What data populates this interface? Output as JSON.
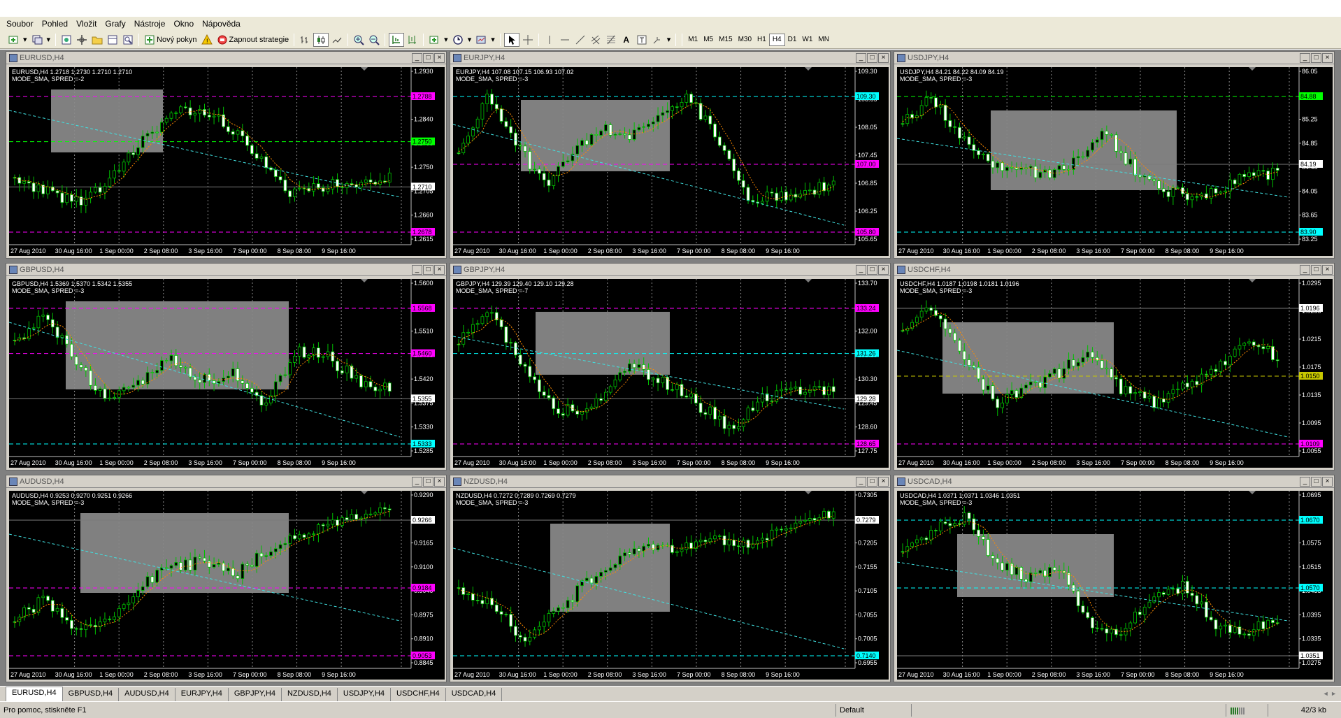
{
  "menu": [
    "Soubor",
    "Pohled",
    "Vložit",
    "Grafy",
    "Nástroje",
    "Okno",
    "Nápověda"
  ],
  "toolbar": {
    "new_order": "Nový pokyn",
    "start_strategies": "Zapnout strategie",
    "timeframes": [
      "M1",
      "M5",
      "M15",
      "M30",
      "H1",
      "H4",
      "D1",
      "W1",
      "MN"
    ],
    "active_timeframe": "H4"
  },
  "x_labels": [
    "27 Aug 2010",
    "30 Aug 16:00",
    "1 Sep 00:00",
    "2 Sep 08:00",
    "3 Sep 16:00",
    "7 Sep 00:00",
    "8 Sep 08:00",
    "9 Sep 16:00"
  ],
  "charts": [
    {
      "title": "EURUSD,H4",
      "info": "EURUSD,H4  1.2718 1.2730 1.2710 1.2710",
      "info2": "MODE_SMA, SPRED =-2",
      "ticks": [
        "1.2930",
        "1.2885",
        "1.2840",
        "1.2795",
        "1.2750",
        "1.2705",
        "1.2660",
        "1.2615"
      ],
      "tags": [
        {
          "text": "1.2788",
          "color": "#ff00ff"
        },
        {
          "text": "1.2750",
          "color": "#00ff00"
        },
        {
          "text": "1.2710",
          "color": "#ffffff"
        },
        {
          "text": "1.2678",
          "color": "#ff00ff"
        }
      ]
    },
    {
      "title": "EURJPY,H4",
      "info": "EURJPY,H4  107.08 107.15 106.93 107.02",
      "info2": "MODE_SMA, SPRED =-3",
      "ticks": [
        "109.30",
        "108.65",
        "108.05",
        "107.45",
        "106.85",
        "106.25",
        "105.65"
      ],
      "tags": [
        {
          "text": "109.30",
          "color": "#00ffff"
        },
        {
          "text": "107.00",
          "color": "#ff00ff"
        },
        {
          "text": "105.80",
          "color": "#ff00ff"
        }
      ]
    },
    {
      "title": "USDJPY,H4",
      "info": "USDJPY,H4  84.21 84.22 84.09 84.19",
      "info2": "MODE_SMA, SPRED =-3",
      "ticks": [
        "86.05",
        "85.65",
        "85.25",
        "84.85",
        "84.45",
        "84.05",
        "83.65",
        "83.25"
      ],
      "tags": [
        {
          "text": "84.88",
          "color": "#00ff00"
        },
        {
          "text": "84.19",
          "color": "#ffffff"
        },
        {
          "text": "83.90",
          "color": "#00ffff"
        }
      ]
    },
    {
      "title": "GBPUSD,H4",
      "info": "GBPUSD,H4  1.5369 1.5370 1.5342 1.5355",
      "info2": "MODE_SMA, SPRED =-3",
      "ticks": [
        "1.5600",
        "1.5555",
        "1.5510",
        "1.5465",
        "1.5420",
        "1.5375",
        "1.5330",
        "1.5285"
      ],
      "tags": [
        {
          "text": "1.5568",
          "color": "#ff00ff"
        },
        {
          "text": "1.5460",
          "color": "#ff00ff"
        },
        {
          "text": "1.5355",
          "color": "#ffffff"
        },
        {
          "text": "1.5333",
          "color": "#00ffff"
        }
      ]
    },
    {
      "title": "GBPJPY,H4",
      "info": "GBPJPY,H4  129.39 129.40 129.10 129.28",
      "info2": "MODE_SMA, SPRED =-7",
      "ticks": [
        "133.70",
        "132.85",
        "132.00",
        "131.15",
        "130.30",
        "129.45",
        "128.60",
        "127.75"
      ],
      "tags": [
        {
          "text": "133.24",
          "color": "#ff00ff"
        },
        {
          "text": "131.26",
          "color": "#00ffff"
        },
        {
          "text": "129.28",
          "color": "#ffffff"
        },
        {
          "text": "128.65",
          "color": "#ff00ff"
        }
      ]
    },
    {
      "title": "USDCHF,H4",
      "info": "USDCHF,H4  1.0187 1.0198 1.0181 1.0196",
      "info2": "MODE_SMA, SPRED =-3",
      "ticks": [
        "1.0295",
        "1.0255",
        "1.0215",
        "1.0175",
        "1.0135",
        "1.0095",
        "1.0055"
      ],
      "tags": [
        {
          "text": "1.0196",
          "color": "#ffffff"
        },
        {
          "text": "1.0150",
          "color": "#c8c800"
        },
        {
          "text": "1.0109",
          "color": "#ff00ff"
        }
      ]
    },
    {
      "title": "AUDUSD,H4",
      "info": "AUDUSD,H4  0.9253 0.9270 0.9251 0.9266",
      "info2": "MODE_SMA, SPRED =-3",
      "ticks": [
        "0.9290",
        "0.9225",
        "0.9165",
        "0.9100",
        "0.9040",
        "0.8975",
        "0.8910",
        "0.8845"
      ],
      "tags": [
        {
          "text": "0.9266",
          "color": "#ffffff"
        },
        {
          "text": "0.9184",
          "color": "#ff00ff"
        },
        {
          "text": "0.9053",
          "color": "#ff00ff"
        }
      ]
    },
    {
      "title": "NZDUSD,H4",
      "info": "NZDUSD,H4  0.7272 0.7289 0.7269 0.7279",
      "info2": "MODE_SMA, SPRED =-3",
      "ticks": [
        "0.7305",
        "0.7255",
        "0.7205",
        "0.7155",
        "0.7105",
        "0.7055",
        "0.7005",
        "0.6955"
      ],
      "tags": [
        {
          "text": "0.7279",
          "color": "#ffffff"
        },
        {
          "text": "0.7140",
          "color": "#00ffff"
        }
      ]
    },
    {
      "title": "USDCAD,H4",
      "info": "USDCAD,H4  1.0371 1.0371 1.0346 1.0351",
      "info2": "MODE_SMA, SPRED =-3",
      "ticks": [
        "1.0695",
        "1.0635",
        "1.0575",
        "1.0515",
        "1.0455",
        "1.0395",
        "1.0335",
        "1.0275"
      ],
      "tags": [
        {
          "text": "1.0670",
          "color": "#00ffff"
        },
        {
          "text": "1.0570",
          "color": "#00ffff"
        },
        {
          "text": "1.0351",
          "color": "#ffffff"
        }
      ]
    }
  ],
  "tabs": [
    "EURUSD,H4",
    "GBPUSD,H4",
    "AUDUSD,H4",
    "EURJPY,H4",
    "GBPJPY,H4",
    "NZDUSD,H4",
    "USDJPY,H4",
    "USDCHF,H4",
    "USDCAD,H4"
  ],
  "status": {
    "help": "Pro pomoc, stiskněte F1",
    "profile": "Default",
    "traffic": "42/3 kb"
  }
}
